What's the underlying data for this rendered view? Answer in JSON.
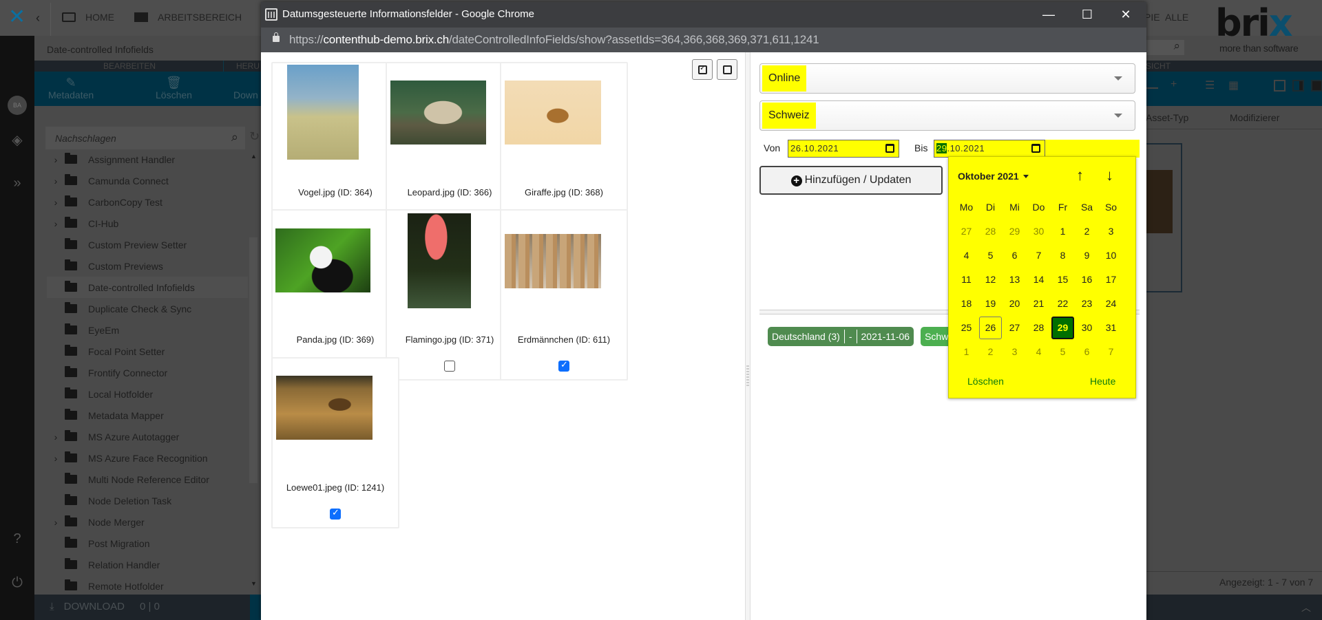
{
  "background_app": {
    "nav": {
      "home": "HOME",
      "workspace": "ARBEITSBEREICH",
      "partial_crumb": "PIE",
      "all": "ALLE"
    },
    "avatar_initials": "BA",
    "page_title": "Date-controlled Infofields",
    "tabs": {
      "edit": "BEARBEITEN",
      "download_partial": "HERU",
      "view_partial": "SICHT"
    },
    "toolbar": {
      "metadata": "Metadaten",
      "delete": "Löschen",
      "download_partial": "Down"
    },
    "tree_search_placeholder": "Nachschlagen",
    "tree_items": [
      {
        "label": "Assignment Handler",
        "expandable": true
      },
      {
        "label": "Camunda Connect",
        "expandable": true
      },
      {
        "label": "CarbonCopy Test",
        "expandable": true
      },
      {
        "label": "CI-Hub",
        "expandable": true
      },
      {
        "label": "Custom Preview Setter",
        "expandable": false
      },
      {
        "label": "Custom Previews",
        "expandable": false
      },
      {
        "label": "Date-controlled Infofields",
        "expandable": false,
        "selected": true
      },
      {
        "label": "Duplicate Check & Sync",
        "expandable": false
      },
      {
        "label": "EyeEm",
        "expandable": false
      },
      {
        "label": "Focal Point Setter",
        "expandable": false
      },
      {
        "label": "Frontify Connector",
        "expandable": false
      },
      {
        "label": "Local Hotfolder",
        "expandable": false
      },
      {
        "label": "Metadata Mapper",
        "expandable": false
      },
      {
        "label": "MS Azure Autotagger",
        "expandable": true
      },
      {
        "label": "MS Azure Face Recognition",
        "expandable": true
      },
      {
        "label": "Multi Node Reference Editor",
        "expandable": false
      },
      {
        "label": "Node Deletion Task",
        "expandable": false
      },
      {
        "label": "Node Merger",
        "expandable": true
      },
      {
        "label": "Post Migration",
        "expandable": false
      },
      {
        "label": "Relation Handler",
        "expandable": false
      },
      {
        "label": "Remote Hotfolder",
        "expandable": false
      }
    ],
    "download_bar": {
      "label": "DOWNLOAD",
      "count": "0 | 0"
    },
    "columns": {
      "asset_type_partial": "Asset-Typ",
      "modifier": "Modifizierer"
    },
    "result_count": "Angezeigt: 1 - 7 von 7",
    "brand": {
      "word_dark": "bri",
      "word_accent": "x",
      "tagline": "more than software"
    }
  },
  "popup": {
    "window_title": "Datumsgesteuerte Informationsfelder - Google Chrome",
    "url_prefix": "https://",
    "url_host": "contenthub-demo.brix.ch",
    "url_path": "/dateControlledInfoFields/show?assetIds=364,366,368,369,371,611,1241",
    "assets": [
      {
        "caption": "Vogel.jpg (ID: 364)",
        "checked": true,
        "subject": "bird"
      },
      {
        "caption": "Leopard.jpg (ID: 366)",
        "checked": true,
        "subject": "leopard"
      },
      {
        "caption": "Giraffe.jpg (ID: 368)",
        "checked": false,
        "subject": "giraffe"
      },
      {
        "caption": "Panda.jpg (ID: 369)",
        "checked": true,
        "subject": "panda"
      },
      {
        "caption": "Flamingo.jpg (ID: 371)",
        "checked": false,
        "subject": "flamingo"
      },
      {
        "caption": "Erdmännchen (ID: 611)",
        "checked": true,
        "subject": "meerkats"
      },
      {
        "caption": "Loewe01.jpeg (ID: 1241)",
        "checked": true,
        "subject": "lion"
      }
    ],
    "form": {
      "status_select": "Online",
      "country_select": "Schweiz",
      "from_label": "Von",
      "from_value": "26.10.2021",
      "to_label": "Bis",
      "to_day": "29",
      "to_rest": ".10.2021",
      "submit_label": "Hinzufügen / Updaten"
    },
    "tags": [
      {
        "country": "Deutschland (3)",
        "from": "-",
        "to": "2021-11-06"
      },
      {
        "country": "Schweiz"
      }
    ],
    "datepicker": {
      "month_label": "Oktober 2021",
      "weekdays": [
        "Mo",
        "Di",
        "Mi",
        "Do",
        "Fr",
        "Sa",
        "So"
      ],
      "weeks": [
        [
          [
            "27",
            1
          ],
          [
            "28",
            1
          ],
          [
            "29",
            1
          ],
          [
            "30",
            1
          ],
          [
            "1",
            0
          ],
          [
            "2",
            0
          ],
          [
            "3",
            0
          ]
        ],
        [
          [
            "4",
            0
          ],
          [
            "5",
            0
          ],
          [
            "6",
            0
          ],
          [
            "7",
            0
          ],
          [
            "8",
            0
          ],
          [
            "9",
            0
          ],
          [
            "10",
            0
          ]
        ],
        [
          [
            "11",
            0
          ],
          [
            "12",
            0
          ],
          [
            "13",
            0
          ],
          [
            "14",
            0
          ],
          [
            "15",
            0
          ],
          [
            "16",
            0
          ],
          [
            "17",
            0
          ]
        ],
        [
          [
            "18",
            0
          ],
          [
            "19",
            0
          ],
          [
            "20",
            0
          ],
          [
            "21",
            0
          ],
          [
            "22",
            0
          ],
          [
            "23",
            0
          ],
          [
            "24",
            0
          ]
        ],
        [
          [
            "25",
            0
          ],
          [
            "26",
            0
          ],
          [
            "27",
            0
          ],
          [
            "28",
            0
          ],
          [
            "29",
            0
          ],
          [
            "30",
            0
          ],
          [
            "31",
            0
          ]
        ],
        [
          [
            "1",
            1
          ],
          [
            "2",
            1
          ],
          [
            "3",
            1
          ],
          [
            "4",
            1
          ],
          [
            "5",
            1
          ],
          [
            "6",
            1
          ],
          [
            "7",
            1
          ]
        ]
      ],
      "range_start_day": "26",
      "selected_day": "29",
      "clear_label": "Löschen",
      "today_label": "Heute"
    }
  }
}
